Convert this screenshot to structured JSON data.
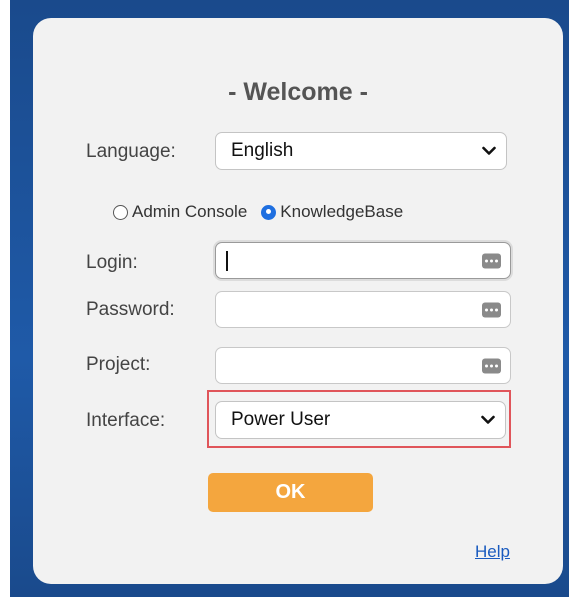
{
  "form": {
    "title": "- Welcome -",
    "language_label": "Language:",
    "language_value": "English",
    "radio_admin_label": "Admin Console",
    "radio_kb_label": "KnowledgeBase",
    "selected_mode": "KnowledgeBase",
    "login_label": "Login:",
    "login_value": "",
    "password_label": "Password:",
    "password_value": "",
    "project_label": "Project:",
    "project_value": "",
    "interface_label": "Interface:",
    "interface_value": "Power User",
    "ok_label": "OK",
    "help_label": "Help"
  },
  "colors": {
    "frame": "#1f5aa8",
    "panel": "#f2f2f2",
    "ok_button": "#f4a63e",
    "highlight": "#e0555a",
    "link": "#1a5bbf",
    "radio_selected": "#1f6fe0"
  },
  "icons": {
    "select_arrow": "chevron-down-icon",
    "field_keychain": "key-dots-icon"
  }
}
